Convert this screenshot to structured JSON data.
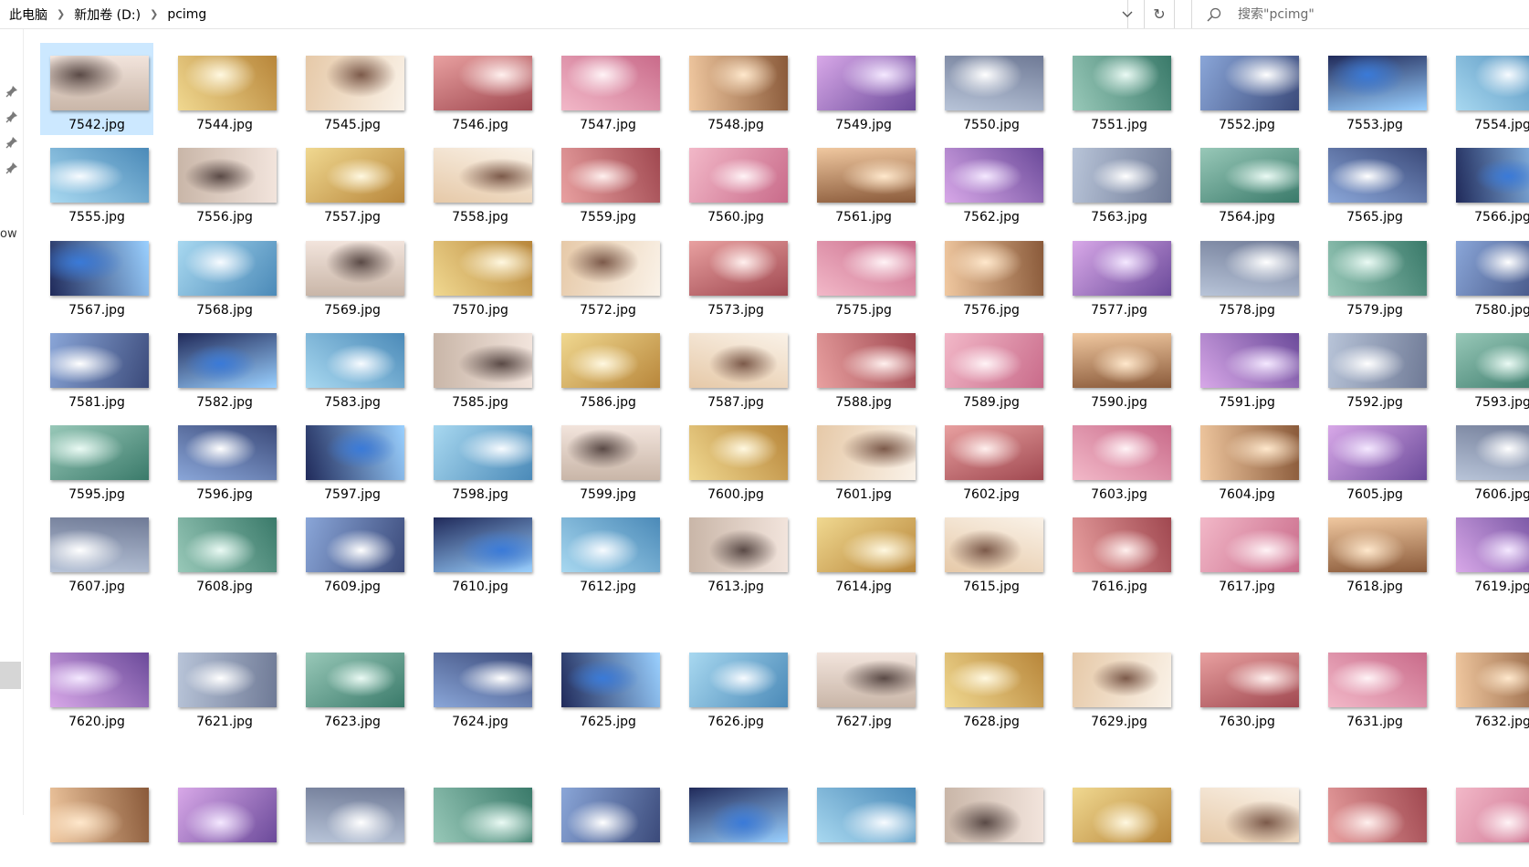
{
  "address": {
    "breadcrumbs": [
      "此电脑",
      "新加卷 (D:)",
      "pcimg"
    ]
  },
  "search": {
    "placeholder": "搜索\"pcimg\""
  },
  "nav": {
    "partial_label": "ow"
  },
  "icons": {
    "breadcrumb_separator": "chevron-right-icon",
    "dropdown": "chevron-down-icon",
    "refresh": "refresh-icon",
    "search": "search-icon",
    "pin": "pin-icon"
  },
  "colors": {
    "selection": "#cce8ff"
  },
  "files": [
    [
      "7542.jpg",
      "7544.jpg",
      "7545.jpg",
      "7546.jpg",
      "7547.jpg",
      "7548.jpg",
      "7549.jpg",
      "7550.jpg",
      "7551.jpg",
      "7552.jpg",
      "7553.jpg",
      "7554.jpg"
    ],
    [
      "7555.jpg",
      "7556.jpg",
      "7557.jpg",
      "7558.jpg",
      "7559.jpg",
      "7560.jpg",
      "7561.jpg",
      "7562.jpg",
      "7563.jpg",
      "7564.jpg",
      "7565.jpg",
      "7566.jpg"
    ],
    [
      "7567.jpg",
      "7568.jpg",
      "7569.jpg",
      "7570.jpg",
      "7572.jpg",
      "7573.jpg",
      "7575.jpg",
      "7576.jpg",
      "7577.jpg",
      "7578.jpg",
      "7579.jpg",
      "7580.jpg"
    ],
    [
      "7581.jpg",
      "7582.jpg",
      "7583.jpg",
      "7585.jpg",
      "7586.jpg",
      "7587.jpg",
      "7588.jpg",
      "7589.jpg",
      "7590.jpg",
      "7591.jpg",
      "7592.jpg",
      "7593.jpg"
    ],
    [
      "7595.jpg",
      "7596.jpg",
      "7597.jpg",
      "7598.jpg",
      "7599.jpg",
      "7600.jpg",
      "7601.jpg",
      "7602.jpg",
      "7603.jpg",
      "7604.jpg",
      "7605.jpg",
      "7606.jpg"
    ],
    [
      "7607.jpg",
      "7608.jpg",
      "7609.jpg",
      "7610.jpg",
      "7612.jpg",
      "7613.jpg",
      "7614.jpg",
      "7615.jpg",
      "7616.jpg",
      "7617.jpg",
      "7618.jpg",
      "7619.jpg"
    ],
    [
      "7620.jpg",
      "7621.jpg",
      "7623.jpg",
      "7624.jpg",
      "7625.jpg",
      "7626.jpg",
      "7627.jpg",
      "7628.jpg",
      "7629.jpg",
      "7630.jpg",
      "7631.jpg",
      "7632.jpg"
    ],
    [
      "",
      "",
      "",
      "",
      "",
      "",
      "",
      "",
      "",
      "",
      "",
      ""
    ]
  ],
  "selected_file": "7542.jpg"
}
